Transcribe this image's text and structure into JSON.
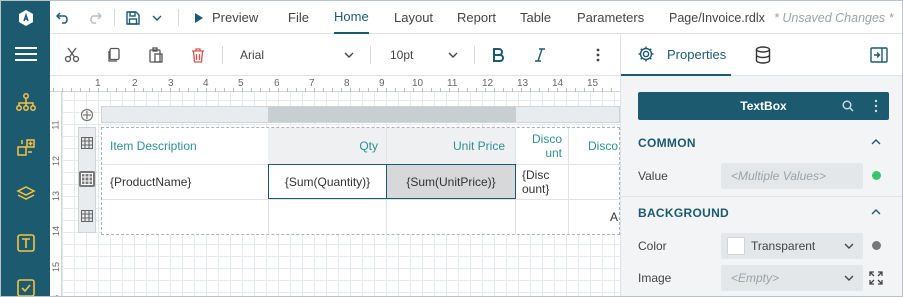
{
  "rail": {
    "items": [
      {
        "icon": "logo-icon"
      },
      {
        "icon": "hamburger-menu-icon"
      },
      {
        "icon": "data-tree-icon"
      },
      {
        "icon": "report-parts-icon"
      },
      {
        "icon": "layers-icon"
      },
      {
        "icon": "textbox-tool-icon"
      },
      {
        "icon": "checkbox-tool-icon"
      }
    ]
  },
  "menubar": {
    "preview_label": "Preview",
    "tabs": [
      {
        "label": "File"
      },
      {
        "label": "Home",
        "active": true
      },
      {
        "label": "Layout"
      },
      {
        "label": "Report"
      },
      {
        "label": "Table"
      },
      {
        "label": "Parameters"
      }
    ],
    "document_name": "Page/Invoice.rdlx",
    "unsaved_label": "* Unsaved Changes *"
  },
  "toolbar": {
    "font_family": "Arial",
    "font_size": "10pt"
  },
  "canvas": {
    "hruler": [
      "1",
      "2",
      "3",
      "4",
      "5",
      "6",
      "7",
      "8",
      "9",
      "10",
      "11",
      "12",
      "13",
      "14",
      "15"
    ],
    "vruler": [
      "11",
      "12",
      "13",
      "14",
      "15",
      "16"
    ],
    "table": {
      "header": [
        "Item Description",
        "Qty",
        "Unit Price",
        "Disco unt",
        "Disco"
      ],
      "detail": [
        "{ProductName}",
        "{Sum(Quantity)}",
        "{Sum(UnitPrice)}",
        "{Disc ount}"
      ],
      "footer_partial": "A"
    }
  },
  "panel": {
    "properties_tab": "Properties",
    "selection_title": "TextBox",
    "sections": {
      "common": "COMMON",
      "background": "BACKGROUND"
    },
    "value_label": "Value",
    "value_placeholder": "<Multiple Values>",
    "color_label": "Color",
    "color_value": "Transparent",
    "image_label": "Image",
    "image_value": "<Empty>"
  },
  "colors": {
    "rail": "#1c5a70",
    "accent": "#1c5a70",
    "header_text": "#2f8f94",
    "status_dot": "#3cc46a"
  }
}
